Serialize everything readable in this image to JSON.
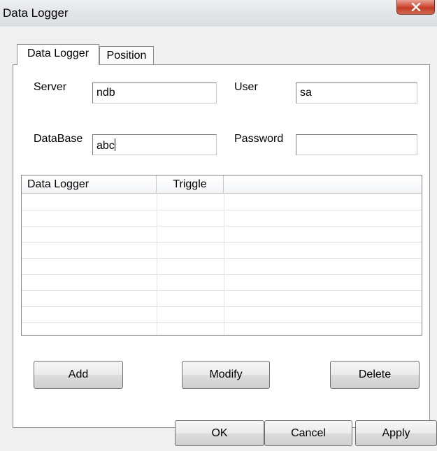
{
  "window": {
    "title": "Data Logger"
  },
  "tabs": [
    {
      "label": "Data Logger",
      "active": true
    },
    {
      "label": "Position",
      "active": false
    }
  ],
  "form": {
    "server_label": "Server",
    "server_value": "ndb",
    "user_label": "User",
    "user_value": "sa",
    "database_label": "DataBase",
    "database_value": "abc",
    "password_label": "Password",
    "password_value": ""
  },
  "list": {
    "columns": [
      "Data Logger",
      "Triggle",
      ""
    ],
    "rows": []
  },
  "actions": {
    "add": "Add",
    "modify": "Modify",
    "delete": "Delete"
  },
  "dialog_buttons": {
    "ok": "OK",
    "cancel": "Cancel",
    "apply": "Apply"
  },
  "icons": {
    "close": "close-icon"
  },
  "colors": {
    "close_button": "#c9432d",
    "background": "#f0f0f0"
  }
}
